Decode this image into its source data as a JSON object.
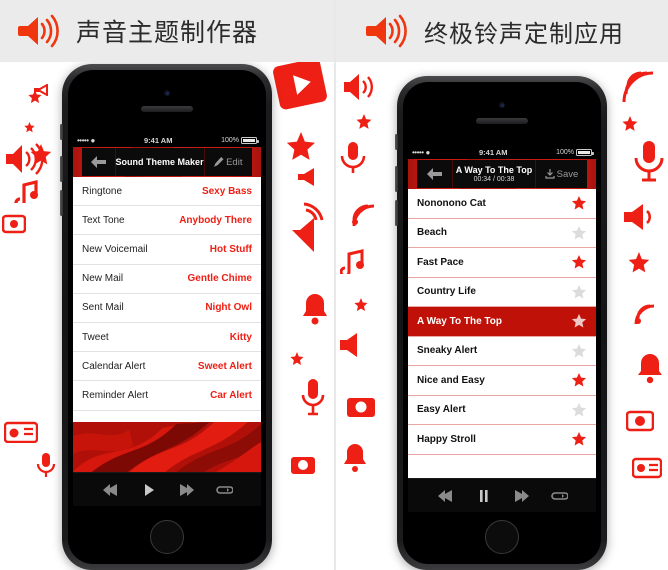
{
  "theme": {
    "accent_red": "#ee2015",
    "dark_red": "#c01108",
    "header_bg": "#ebebeb",
    "star_on": "#ee2015",
    "star_off": "#dcdcdc"
  },
  "panels": [
    {
      "header": {
        "title": "声音主题制作器",
        "icon": "speaker-icon"
      },
      "status_bar": {
        "signal": "•••••",
        "wifi": "wifi-icon",
        "time": "9:41 AM",
        "battery_pct": "100%"
      },
      "nav": {
        "back_icon": "back-arrow-icon",
        "title": "Sound Theme Maker",
        "subtitle": "",
        "action_label": "Edit",
        "action_icon": "pencil-icon"
      },
      "list": [
        {
          "label": "Ringtone",
          "value": "Sexy Bass"
        },
        {
          "label": "Text Tone",
          "value": "Anybody There"
        },
        {
          "label": "New Voicemail",
          "value": "Hot Stuff"
        },
        {
          "label": "New Mail",
          "value": "Gentle Chime"
        },
        {
          "label": "Sent Mail",
          "value": "Night Owl"
        },
        {
          "label": "Tweet",
          "value": "Kitty"
        },
        {
          "label": "Calendar Alert",
          "value": "Sweet Alert"
        },
        {
          "label": "Reminder Alert",
          "value": "Car Alert"
        }
      ],
      "controls": [
        {
          "name": "rewind-icon",
          "icon": "rewind"
        },
        {
          "name": "play-icon",
          "icon": "play"
        },
        {
          "name": "forward-icon",
          "icon": "forward"
        },
        {
          "name": "repeat-icon",
          "icon": "repeat"
        }
      ]
    },
    {
      "header": {
        "title": "终极铃声定制应用",
        "icon": "speaker-icon"
      },
      "status_bar": {
        "signal": "•••••",
        "wifi": "wifi-icon",
        "time": "9:41 AM",
        "battery_pct": "100%"
      },
      "nav": {
        "back_icon": "back-arrow-icon",
        "title": "A Way To The Top",
        "subtitle": "00:34 / 00:38",
        "action_label": "Save",
        "action_icon": "save-icon"
      },
      "list": [
        {
          "label": "Nononono Cat",
          "starred": true,
          "selected": false
        },
        {
          "label": "Beach",
          "starred": false,
          "selected": false
        },
        {
          "label": "Fast Pace",
          "starred": true,
          "selected": false
        },
        {
          "label": "Country Life",
          "starred": false,
          "selected": false
        },
        {
          "label": "A Way To The Top",
          "starred": true,
          "selected": true
        },
        {
          "label": "Sneaky Alert",
          "starred": false,
          "selected": false
        },
        {
          "label": "Nice and Easy",
          "starred": true,
          "selected": false
        },
        {
          "label": "Easy Alert",
          "starred": false,
          "selected": false
        },
        {
          "label": "Happy Stroll",
          "starred": true,
          "selected": false
        }
      ],
      "controls": [
        {
          "name": "rewind-icon",
          "icon": "rewind"
        },
        {
          "name": "pause-icon",
          "icon": "pause"
        },
        {
          "name": "forward-icon",
          "icon": "forward"
        },
        {
          "name": "repeat-icon",
          "icon": "repeat"
        }
      ]
    }
  ]
}
